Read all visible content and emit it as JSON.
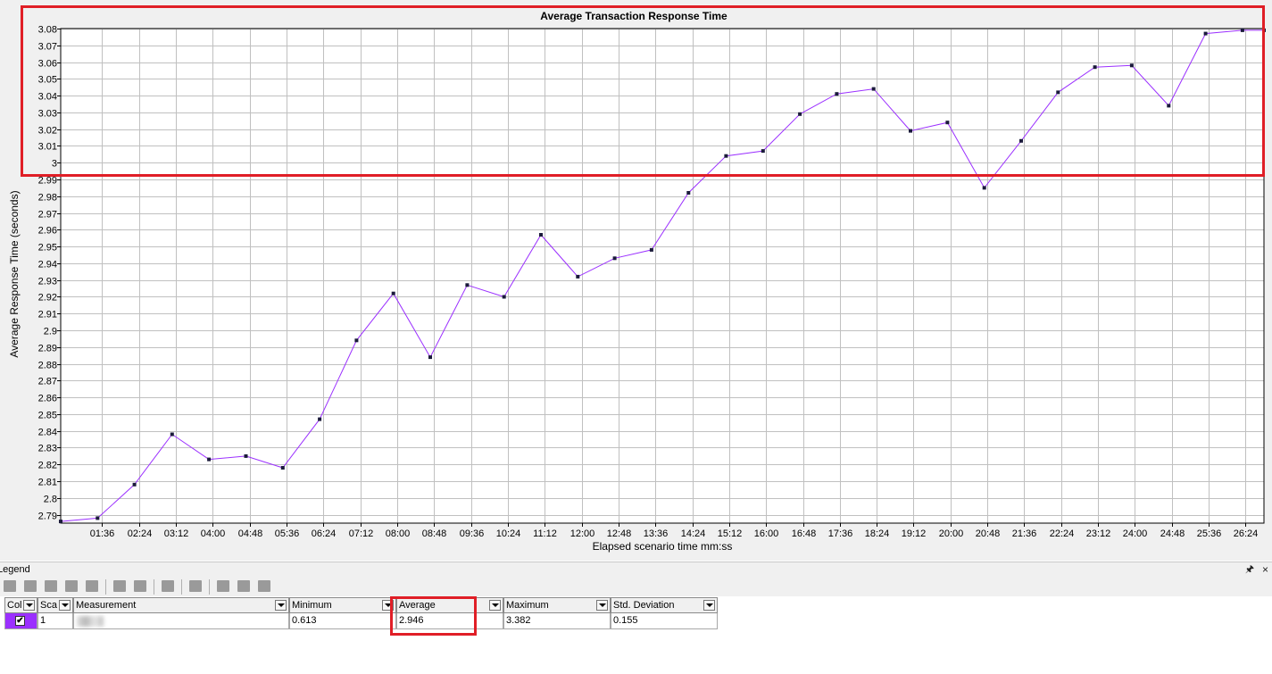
{
  "chart_data": {
    "type": "line",
    "title": "Average Transaction Response Time",
    "xlabel": "Elapsed scenario time mm:ss",
    "ylabel": "Average Response Time (seconds)",
    "ylim": [
      2.785,
      3.08
    ],
    "yticks": [
      2.79,
      2.8,
      2.81,
      2.82,
      2.83,
      2.84,
      2.85,
      2.86,
      2.87,
      2.88,
      2.89,
      2.9,
      2.91,
      2.92,
      2.93,
      2.94,
      2.95,
      2.96,
      2.97,
      2.98,
      2.99,
      3,
      3.01,
      3.02,
      3.03,
      3.04,
      3.05,
      3.06,
      3.07,
      3.08
    ],
    "ytick_labels": [
      "2.79",
      "2.8",
      "2.81",
      "2.82",
      "2.83",
      "2.84",
      "2.85",
      "2.86",
      "2.87",
      "2.88",
      "2.89",
      "2.9",
      "2.91",
      "2.92",
      "2.93",
      "2.94",
      "2.95",
      "2.96",
      "2.97",
      "2.98",
      "2.99",
      "3",
      "3.01",
      "3.02",
      "3.03",
      "3.04",
      "3.05",
      "3.06",
      "3.07",
      "3.08"
    ],
    "xlim_seconds": [
      42,
      1608
    ],
    "xticks_seconds": [
      96,
      144,
      192,
      240,
      288,
      336,
      384,
      432,
      480,
      528,
      576,
      624,
      672,
      720,
      768,
      816,
      864,
      912,
      960,
      1008,
      1056,
      1104,
      1152,
      1200,
      1248,
      1296,
      1344,
      1392,
      1440,
      1488,
      1536,
      1584
    ],
    "xtick_labels": [
      "01:36",
      "02:24",
      "03:12",
      "04:00",
      "04:48",
      "05:36",
      "06:24",
      "07:12",
      "08:00",
      "08:48",
      "09:36",
      "10:24",
      "11:12",
      "12:00",
      "12:48",
      "13:36",
      "14:24",
      "15:12",
      "16:00",
      "16:48",
      "17:36",
      "18:24",
      "19:12",
      "20:00",
      "20:48",
      "21:36",
      "22:24",
      "23:12",
      "24:00",
      "24:48",
      "25:36",
      "26:24"
    ],
    "grid": true,
    "series": [
      {
        "color": "#9b30ff",
        "x_seconds": [
          42,
          90,
          138,
          187,
          235,
          283,
          331,
          379,
          427,
          475,
          523,
          571,
          619,
          667,
          715,
          763,
          811,
          859,
          908,
          956,
          1004,
          1052,
          1100,
          1148,
          1196,
          1244,
          1292,
          1340,
          1388,
          1436,
          1484,
          1532,
          1580,
          1608
        ],
        "y": [
          2.786,
          2.788,
          2.808,
          2.838,
          2.823,
          2.825,
          2.818,
          2.847,
          2.894,
          2.922,
          2.884,
          2.927,
          2.92,
          2.957,
          2.932,
          2.943,
          2.948,
          2.982,
          3.004,
          3.007,
          3.029,
          3.041,
          3.044,
          3.019,
          3.024,
          2.985,
          3.013,
          3.042,
          3.057,
          3.058,
          3.034,
          3.077,
          3.079,
          3.079
        ]
      }
    ]
  },
  "legend_panel": {
    "title": "Legend",
    "pin_icon": "pin-icon",
    "close_label": "×",
    "columns": {
      "color": "Col",
      "scale": "Sca",
      "measurement": "Measurement",
      "minimum": "Minimum",
      "average": "Average",
      "maximum": "Maximum",
      "std_dev": "Std. Deviation"
    },
    "row": {
      "checked_mark": "✔",
      "scale": "1",
      "minimum": "0.613",
      "average": "2.946",
      "maximum": "3.382",
      "std_dev": "0.155"
    }
  },
  "highlight_color": "#e01e26"
}
